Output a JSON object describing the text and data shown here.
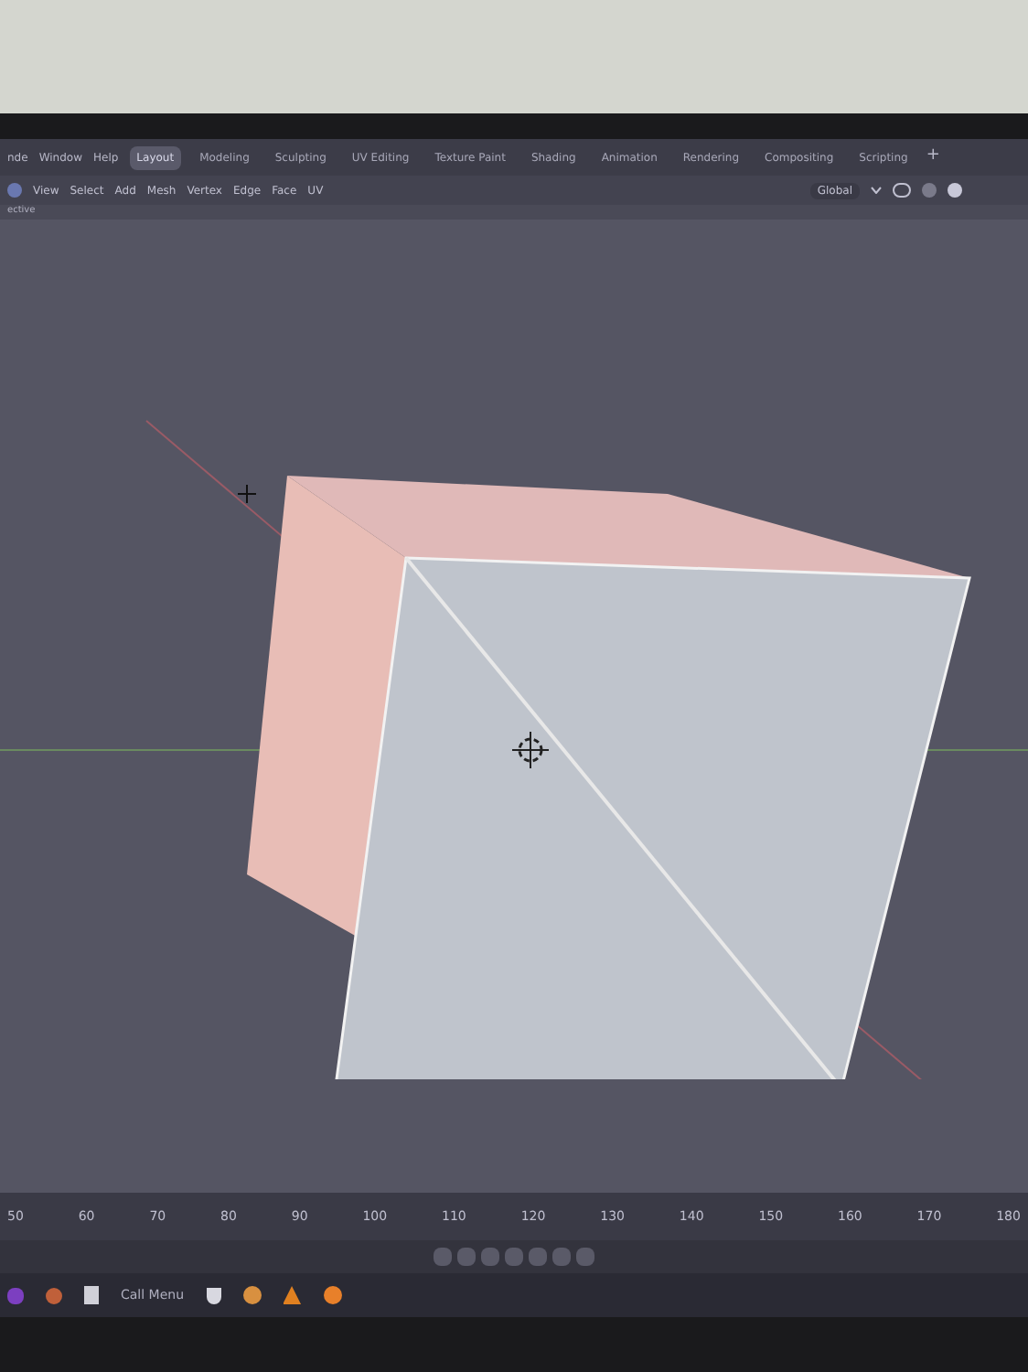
{
  "menu": [
    "nde",
    "Window",
    "Help"
  ],
  "workspace_tabs": [
    {
      "label": "Layout",
      "selected": true
    },
    {
      "label": "Modeling",
      "selected": false
    },
    {
      "label": "Sculpting",
      "selected": false
    },
    {
      "label": "UV Editing",
      "selected": false
    },
    {
      "label": "Texture Paint",
      "selected": false
    },
    {
      "label": "Shading",
      "selected": false
    },
    {
      "label": "Animation",
      "selected": false
    },
    {
      "label": "Rendering",
      "selected": false
    },
    {
      "label": "Compositing",
      "selected": false
    },
    {
      "label": "Scripting",
      "selected": false
    }
  ],
  "add_tab": "+",
  "header": {
    "menus": [
      "View",
      "Select",
      "Add",
      "Mesh",
      "Vertex",
      "Edge",
      "Face",
      "UV"
    ],
    "orientation": "Global"
  },
  "mode_label": "ective",
  "timeline": {
    "frames": [
      "50",
      "60",
      "70",
      "80",
      "90",
      "100",
      "110",
      "120",
      "130",
      "140",
      "150",
      "160",
      "170",
      "180"
    ]
  },
  "taskbar": {
    "call_menu": "Call Menu"
  }
}
